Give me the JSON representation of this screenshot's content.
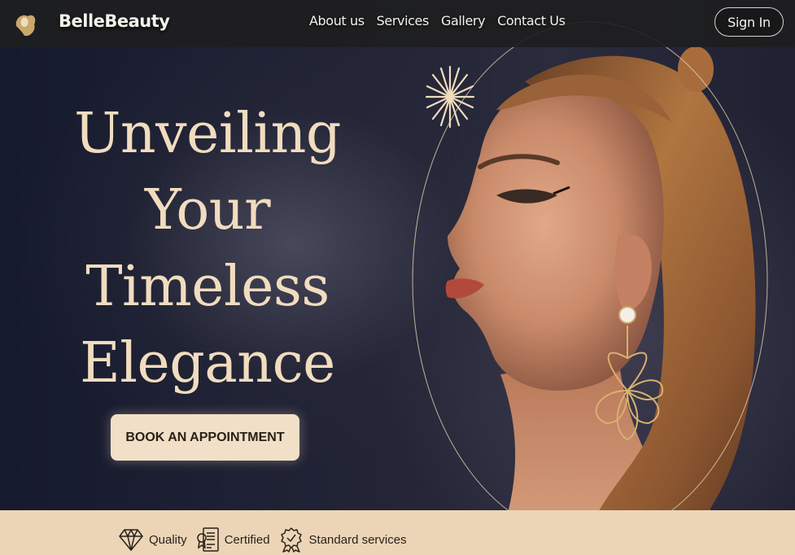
{
  "header": {
    "brand": "BelleBeauty",
    "logo_icon": "woman-silhouette-logo-icon",
    "nav": [
      {
        "label": "About us"
      },
      {
        "label": "Services"
      },
      {
        "label": "Gallery"
      },
      {
        "label": "Contact Us"
      }
    ],
    "signin_label": "Sign In"
  },
  "hero": {
    "headline": [
      "Unveiling",
      "Your",
      "Timeless",
      "Elegance"
    ],
    "cta_label": "BOOK AN APPOINTMENT",
    "decor_icon": "starburst-icon",
    "image": "woman-profile-portrait"
  },
  "features": [
    {
      "icon": "diamond-icon",
      "label": "Quality"
    },
    {
      "icon": "certificate-icon",
      "label": "Certified"
    },
    {
      "icon": "award-badge-icon",
      "label": "Standard services"
    }
  ],
  "colors": {
    "background": "#1a1c2c",
    "accent_cream": "#f2dfc7",
    "headline_text": "#f1dcbf",
    "features_bar": "#ecd5b7",
    "nav_bar": "#1e1e20"
  }
}
